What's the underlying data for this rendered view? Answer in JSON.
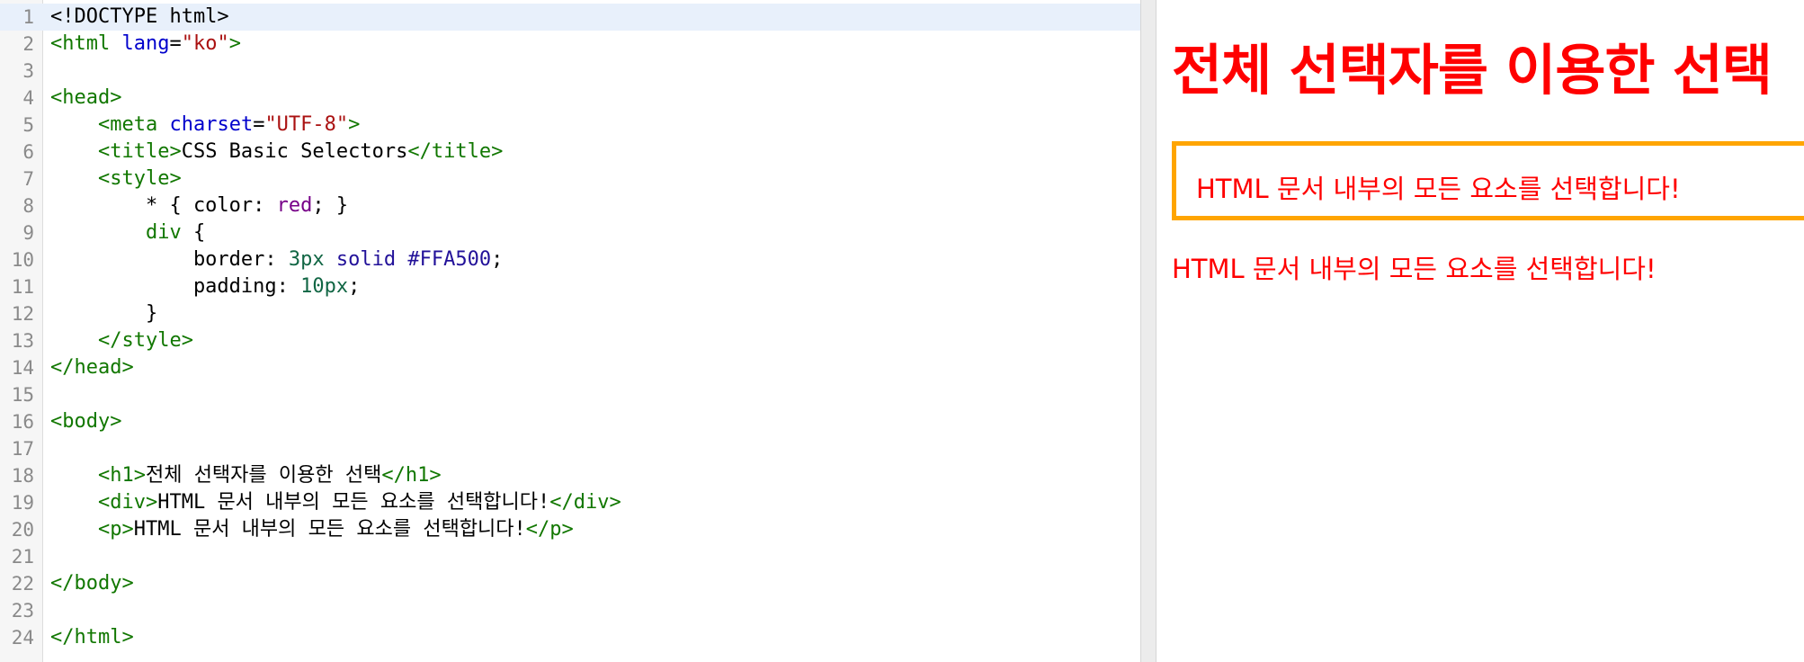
{
  "editor": {
    "active_line": 1,
    "lines": [
      {
        "n": "1",
        "tokens": [
          [
            "plain",
            "<!DOCTYPE html>"
          ]
        ]
      },
      {
        "n": "2",
        "tokens": [
          [
            "tag",
            "<html "
          ],
          [
            "attr",
            "lang"
          ],
          [
            "plain",
            "="
          ],
          [
            "str",
            "\"ko\""
          ],
          [
            "tag",
            ">"
          ]
        ]
      },
      {
        "n": "3",
        "tokens": []
      },
      {
        "n": "4",
        "tokens": [
          [
            "tag",
            "<head>"
          ]
        ]
      },
      {
        "n": "5",
        "tokens": [
          [
            "plain",
            "    "
          ],
          [
            "tag",
            "<meta "
          ],
          [
            "attr",
            "charset"
          ],
          [
            "plain",
            "="
          ],
          [
            "str",
            "\"UTF-8\""
          ],
          [
            "tag",
            ">"
          ]
        ]
      },
      {
        "n": "6",
        "tokens": [
          [
            "plain",
            "    "
          ],
          [
            "tag",
            "<title>"
          ],
          [
            "plain",
            "CSS Basic Selectors"
          ],
          [
            "tag",
            "</title>"
          ]
        ]
      },
      {
        "n": "7",
        "tokens": [
          [
            "plain",
            "    "
          ],
          [
            "tag",
            "<style>"
          ]
        ]
      },
      {
        "n": "8",
        "tokens": [
          [
            "plain",
            "        * { color: "
          ],
          [
            "kw",
            "red"
          ],
          [
            "plain",
            "; }"
          ]
        ]
      },
      {
        "n": "9",
        "tokens": [
          [
            "plain",
            "        "
          ],
          [
            "tag",
            "div"
          ],
          [
            "plain",
            " {"
          ]
        ]
      },
      {
        "n": "10",
        "tokens": [
          [
            "plain",
            "            border: "
          ],
          [
            "num",
            "3px"
          ],
          [
            "plain",
            " "
          ],
          [
            "atom",
            "solid"
          ],
          [
            "plain",
            " "
          ],
          [
            "atom",
            "#FFA500"
          ],
          [
            "plain",
            ";"
          ]
        ]
      },
      {
        "n": "11",
        "tokens": [
          [
            "plain",
            "            padding: "
          ],
          [
            "num",
            "10px"
          ],
          [
            "plain",
            ";"
          ]
        ]
      },
      {
        "n": "12",
        "tokens": [
          [
            "plain",
            "        }"
          ]
        ]
      },
      {
        "n": "13",
        "tokens": [
          [
            "plain",
            "    "
          ],
          [
            "tag",
            "</style>"
          ]
        ]
      },
      {
        "n": "14",
        "tokens": [
          [
            "tag",
            "</head>"
          ]
        ]
      },
      {
        "n": "15",
        "tokens": []
      },
      {
        "n": "16",
        "tokens": [
          [
            "tag",
            "<body>"
          ]
        ]
      },
      {
        "n": "17",
        "tokens": []
      },
      {
        "n": "18",
        "tokens": [
          [
            "plain",
            "    "
          ],
          [
            "tag",
            "<h1>"
          ],
          [
            "plain",
            "전체 선택자를 이용한 선택"
          ],
          [
            "tag",
            "</h1>"
          ]
        ]
      },
      {
        "n": "19",
        "tokens": [
          [
            "plain",
            "    "
          ],
          [
            "tag",
            "<div>"
          ],
          [
            "plain",
            "HTML 문서 내부의 모든 요소를 선택합니다!"
          ],
          [
            "tag",
            "</div>"
          ]
        ]
      },
      {
        "n": "20",
        "tokens": [
          [
            "plain",
            "    "
          ],
          [
            "tag",
            "<p>"
          ],
          [
            "plain",
            "HTML 문서 내부의 모든 요소를 선택합니다!"
          ],
          [
            "tag",
            "</p>"
          ]
        ]
      },
      {
        "n": "21",
        "tokens": []
      },
      {
        "n": "22",
        "tokens": [
          [
            "tag",
            "</body>"
          ]
        ]
      },
      {
        "n": "23",
        "tokens": []
      },
      {
        "n": "24",
        "tokens": [
          [
            "tag",
            "</html>"
          ]
        ]
      }
    ]
  },
  "preview": {
    "heading": "전체 선택자를 이용한 선택",
    "div_text": "HTML 문서 내부의 모든 요소를 선택합니다!",
    "p_text": "HTML 문서 내부의 모든 요소를 선택합니다!",
    "text_color": "#ff0000",
    "border_color": "#FFA500"
  }
}
